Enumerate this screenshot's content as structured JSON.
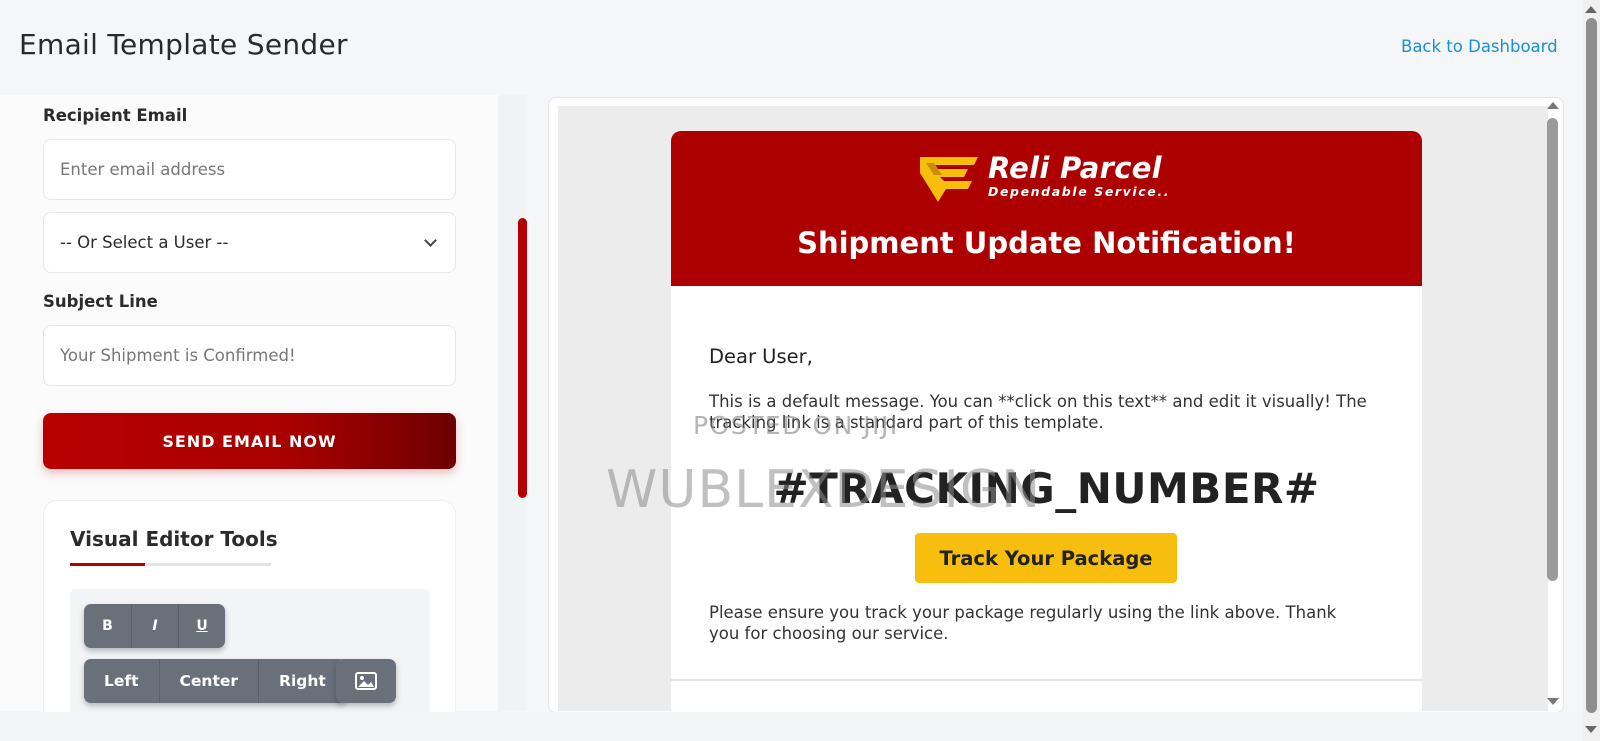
{
  "header": {
    "title": "Email Template Sender",
    "back_link": "Back to Dashboard"
  },
  "form": {
    "recipient_label": "Recipient Email",
    "recipient_placeholder": "Enter email address",
    "user_select_value": "-- Or Select a User --",
    "subject_label": "Subject Line",
    "subject_value": "Your Shipment is Confirmed!",
    "send_button": "SEND EMAIL NOW"
  },
  "tools": {
    "title": "Visual Editor Tools",
    "format_buttons": [
      "B",
      "I",
      "U"
    ],
    "align_buttons": [
      "Left",
      "Center",
      "Right"
    ],
    "image_button_icon": "image-icon"
  },
  "email": {
    "brand_name": "Reli Parcel",
    "brand_tagline": "Dependable Service..",
    "headline": "Shipment Update Notification!",
    "greeting": "Dear User,",
    "intro": "This is a default message. You can **click on this text** and edit it visually! The tracking link is a standard part of this template.",
    "tracking_placeholder": "#TRACKING_NUMBER#",
    "track_button": "Track Your Package",
    "outro": "Please ensure you track your package regularly using the link above. Thank you for choosing our service."
  },
  "watermark": {
    "line1": "POSTED ON JIJI",
    "line2": "WUBLEXDESIGN"
  },
  "colors": {
    "brand_red": "#ad0000",
    "accent_yellow": "#f7be0d",
    "link_blue": "#1b8fd8"
  }
}
